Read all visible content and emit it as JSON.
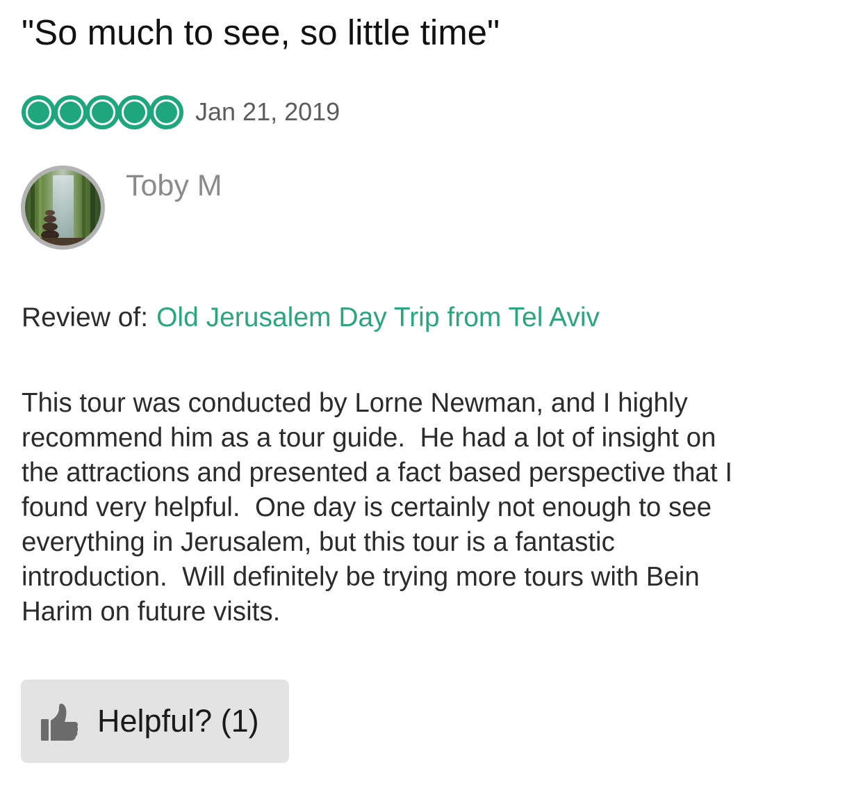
{
  "review": {
    "title": "\"So much to see, so little time\"",
    "rating": 5,
    "rating_max": 5,
    "date": "Jan 21, 2019",
    "reviewer": {
      "name": "Toby M"
    },
    "review_of": {
      "label": "Review of:",
      "link_text": "Old Jerusalem Day Trip from Tel Aviv"
    },
    "body_lines": [
      "This tour was conducted by Lorne Newman, and I highly",
      "recommend him as a tour guide.  He had a lot of insight on",
      "the attractions and presented a fact based perspective that I",
      "found very helpful.  One day is certainly not enough to see",
      "everything in Jerusalem, but this tour is a fantastic",
      "introduction.  Will definitely be trying more tours with Bein",
      "Harim on future visits."
    ],
    "helpful": {
      "label": "Helpful? (1)",
      "icon": "thumbs-up-icon"
    }
  },
  "colors": {
    "bubble_green": "#1ea77c",
    "link_green": "#2aa57c",
    "avatar_ring": "#b3b3b3",
    "button_bg": "#e3e3e3"
  }
}
